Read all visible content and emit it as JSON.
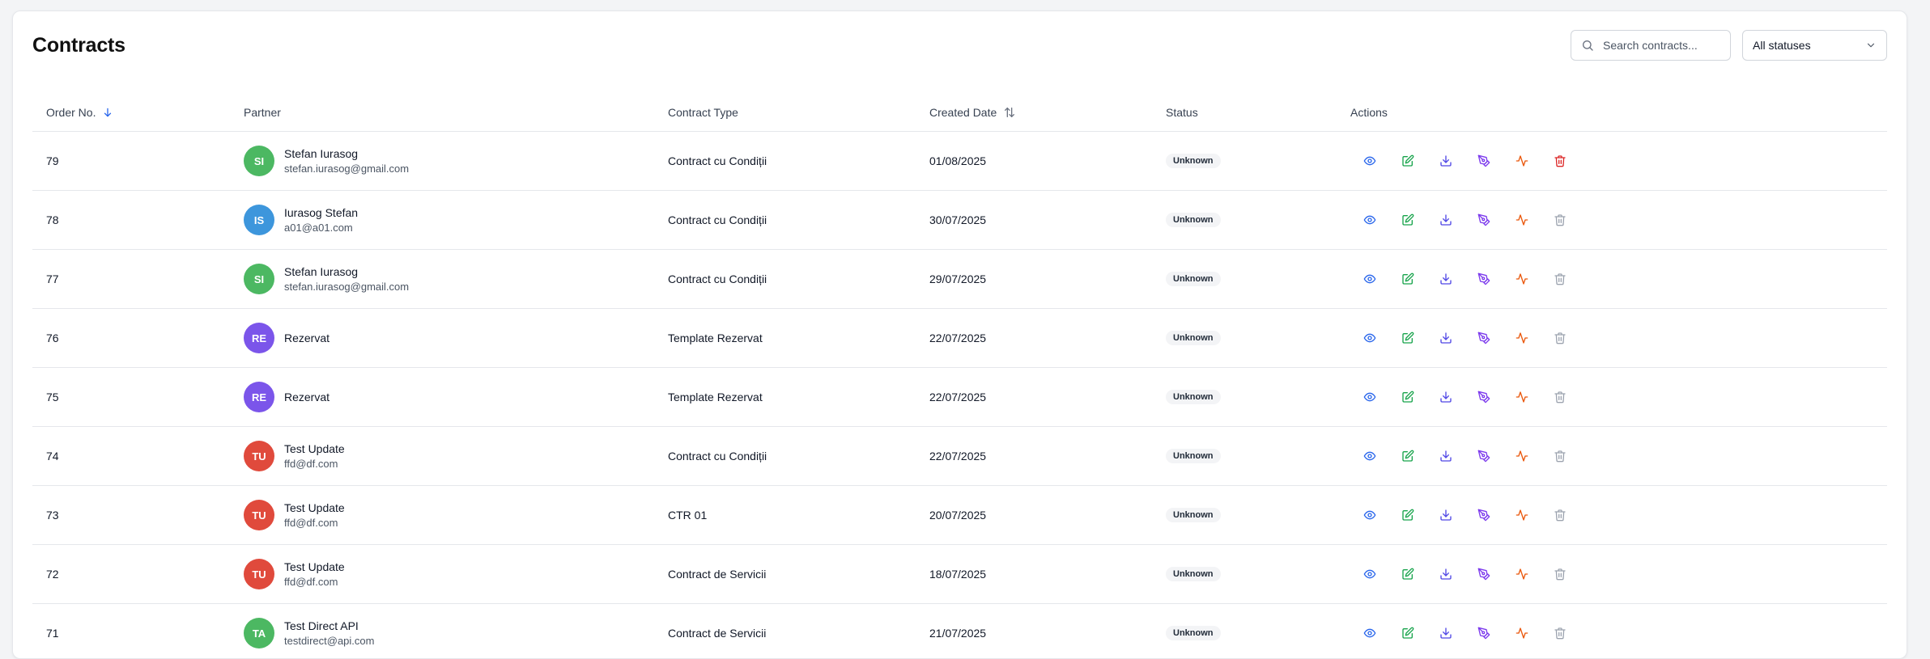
{
  "header": {
    "title": "Contracts"
  },
  "search": {
    "placeholder": "Search contracts..."
  },
  "status_filter": {
    "selected": "All statuses"
  },
  "columns": {
    "order": "Order No.",
    "partner": "Partner",
    "type": "Contract Type",
    "created": "Created Date",
    "status": "Status",
    "actions": "Actions"
  },
  "colors": {
    "view": "#2563eb",
    "edit": "#16a34a",
    "download": "#4f46e5",
    "sign": "#7c3aed",
    "activity": "#ea580c",
    "delete_active": "#dc2626",
    "delete_muted": "#9ca3af"
  },
  "rows": [
    {
      "order": "79",
      "initials": "SI",
      "avatar_color": "#4cb862",
      "name": "Stefan Iurasog",
      "email": "stefan.iurasog@gmail.com",
      "type": "Contract cu Condiții",
      "date": "01/08/2025",
      "status": "Unknown",
      "delete_active": true
    },
    {
      "order": "78",
      "initials": "IS",
      "avatar_color": "#3d96dc",
      "name": "Iurasog Stefan",
      "email": "a01@a01.com",
      "type": "Contract cu Condiții",
      "date": "30/07/2025",
      "status": "Unknown",
      "delete_active": false
    },
    {
      "order": "77",
      "initials": "SI",
      "avatar_color": "#4cb862",
      "name": "Stefan Iurasog",
      "email": "stefan.iurasog@gmail.com",
      "type": "Contract cu Condiții",
      "date": "29/07/2025",
      "status": "Unknown",
      "delete_active": false
    },
    {
      "order": "76",
      "initials": "RE",
      "avatar_color": "#7b55ea",
      "name": "Rezervat",
      "email": "",
      "type": "Template Rezervat",
      "date": "22/07/2025",
      "status": "Unknown",
      "delete_active": false
    },
    {
      "order": "75",
      "initials": "RE",
      "avatar_color": "#7b55ea",
      "name": "Rezervat",
      "email": "",
      "type": "Template Rezervat",
      "date": "22/07/2025",
      "status": "Unknown",
      "delete_active": false
    },
    {
      "order": "74",
      "initials": "TU",
      "avatar_color": "#e04a3c",
      "name": "Test Update",
      "email": "ffd@df.com",
      "type": "Contract cu Condiții",
      "date": "22/07/2025",
      "status": "Unknown",
      "delete_active": false
    },
    {
      "order": "73",
      "initials": "TU",
      "avatar_color": "#e04a3c",
      "name": "Test Update",
      "email": "ffd@df.com",
      "type": "CTR 01",
      "date": "20/07/2025",
      "status": "Unknown",
      "delete_active": false
    },
    {
      "order": "72",
      "initials": "TU",
      "avatar_color": "#e04a3c",
      "name": "Test Update",
      "email": "ffd@df.com",
      "type": "Contract de Servicii",
      "date": "18/07/2025",
      "status": "Unknown",
      "delete_active": false
    },
    {
      "order": "71",
      "initials": "TA",
      "avatar_color": "#4cb862",
      "name": "Test Direct API",
      "email": "testdirect@api.com",
      "type": "Contract de Servicii",
      "date": "21/07/2025",
      "status": "Unknown",
      "delete_active": false
    }
  ]
}
